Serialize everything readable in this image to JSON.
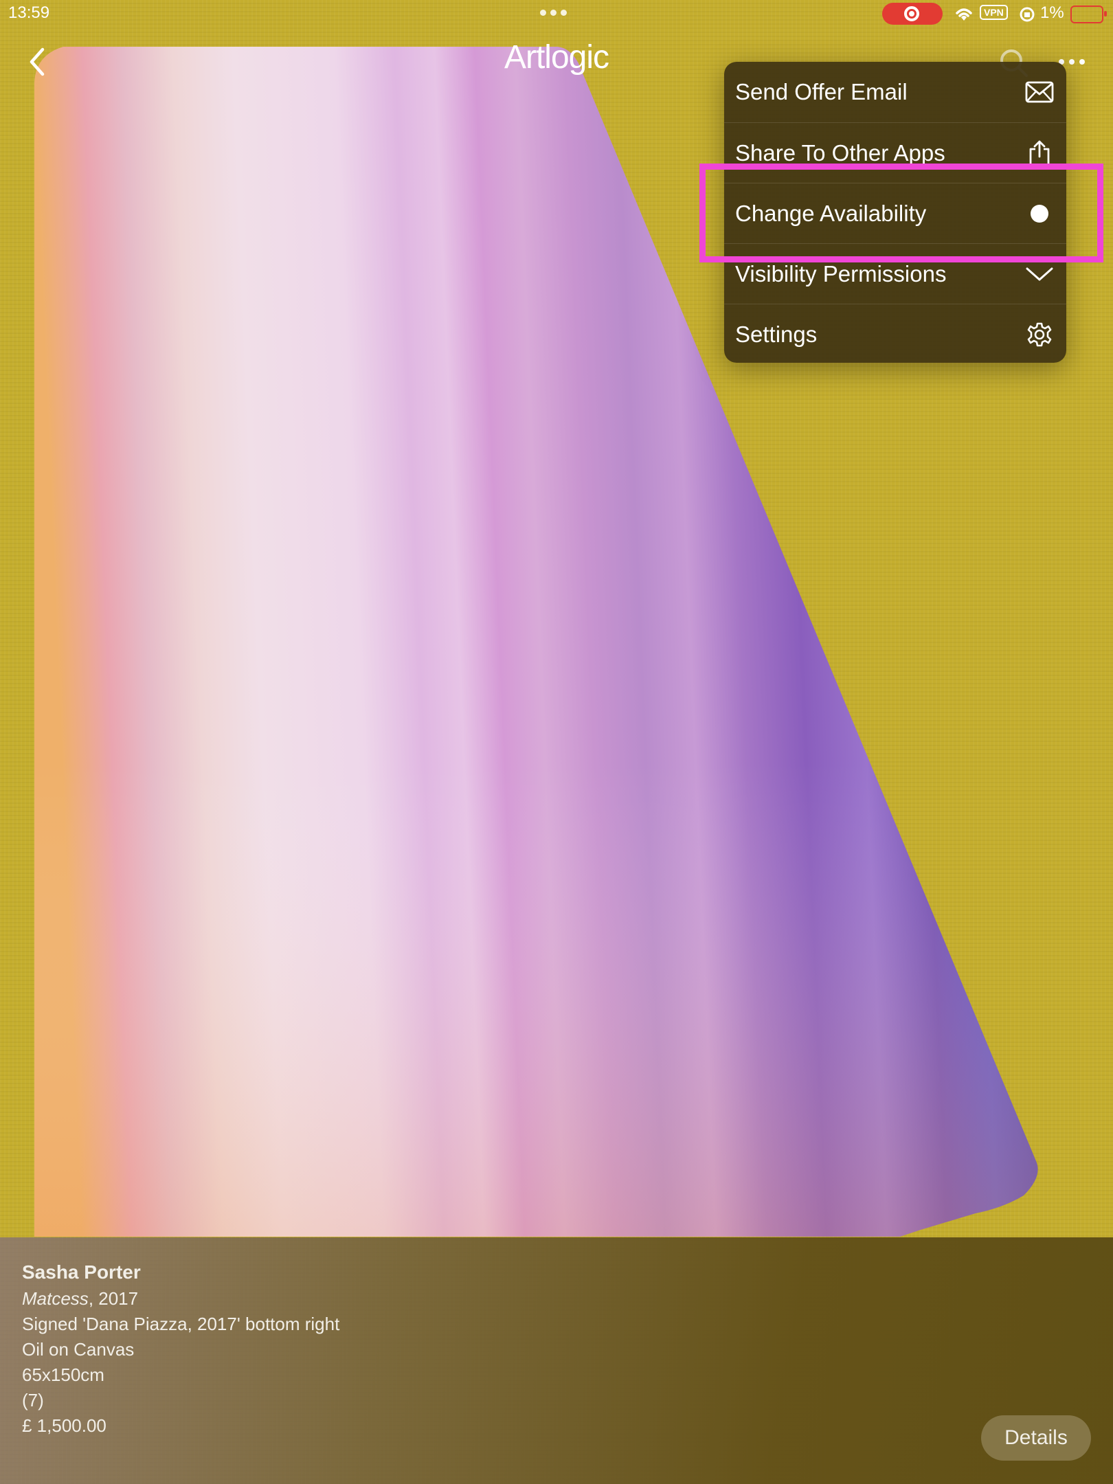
{
  "status_bar": {
    "time": "13:59",
    "vpn_label": "VPN",
    "battery_percent": "1%"
  },
  "header": {
    "brand": "Artlogic"
  },
  "menu": {
    "items": [
      {
        "label": "Send Offer Email",
        "icon": "envelope-icon"
      },
      {
        "label": "Share To Other Apps",
        "icon": "share-icon"
      },
      {
        "label": "Change Availability",
        "icon": "availability-dot-icon"
      },
      {
        "label": "Visibility Permissions",
        "icon": "chevron-down-icon"
      },
      {
        "label": "Settings",
        "icon": "gear-icon"
      }
    ],
    "highlighted_item": "Change Availability"
  },
  "artwork": {
    "artist": "Sasha Porter",
    "title": "Matcess",
    "year_suffix": ", 2017",
    "inscription": "Signed 'Dana Piazza, 2017' bottom right",
    "medium": "Oil on Canvas",
    "dimensions": "65x150cm",
    "edition": "(7)",
    "price": "£ 1,500.00"
  },
  "details_button": "Details",
  "colors": {
    "background": "#c5ae2e",
    "menu_background": "#3e3212",
    "highlight": "#f045d6",
    "status_record": "#e23b33"
  }
}
